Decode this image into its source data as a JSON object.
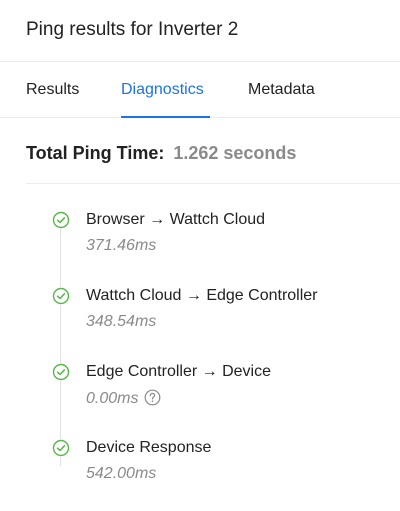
{
  "header": {
    "title": "Ping results for Inverter 2"
  },
  "tabs": [
    {
      "label": "Results",
      "active": false
    },
    {
      "label": "Diagnostics",
      "active": true
    },
    {
      "label": "Metadata",
      "active": false
    }
  ],
  "summary": {
    "label": "Total Ping Time:",
    "value": "1.262 seconds"
  },
  "steps": [
    {
      "title": "Browser → Wattch Cloud",
      "time": "371.46ms",
      "status": "check-circle-icon"
    },
    {
      "title": "Wattch Cloud → Edge Controller",
      "time": "348.54ms",
      "status": "check-circle-icon"
    },
    {
      "title": "Edge Controller → Device",
      "time": "0.00ms",
      "status": "check-circle-icon",
      "help": "question-circle-icon"
    },
    {
      "title": "Device Response",
      "time": "542.00ms",
      "status": "check-circle-icon"
    }
  ],
  "colors": {
    "accent": "#1a73e8",
    "success": "#58b547",
    "muted": "#8a8a8a"
  }
}
